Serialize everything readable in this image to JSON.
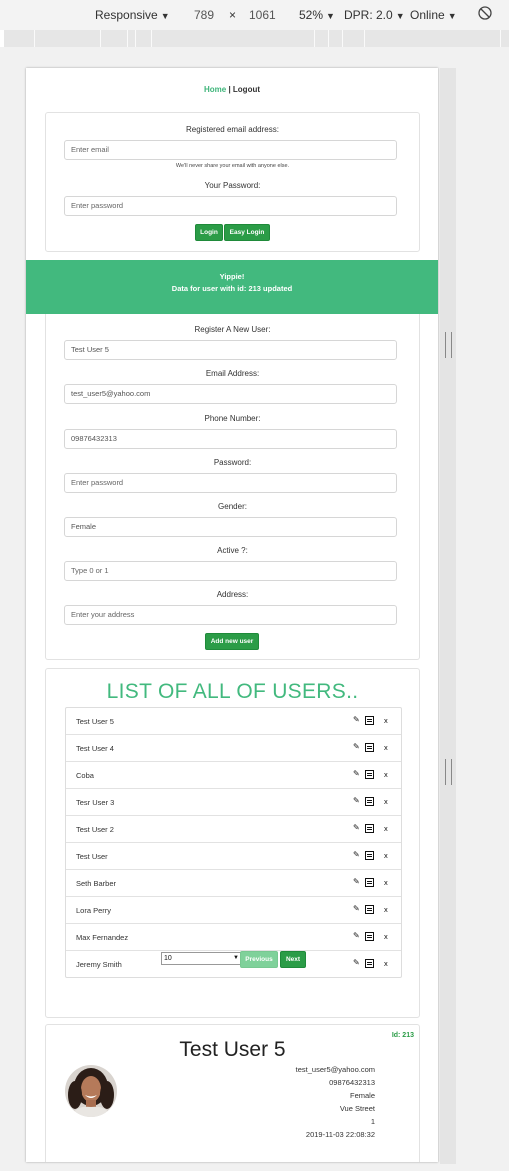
{
  "devtools": {
    "device": "Responsive",
    "width": "789",
    "times": "×",
    "height": "1061",
    "zoom": "52%",
    "dpr": "DPR: 2.0",
    "network": "Online"
  },
  "nav": {
    "home": "Home",
    "sep": " | ",
    "logout": "Logout"
  },
  "login": {
    "email_label": "Registered email address:",
    "email_placeholder": "Enter email",
    "email_hint": "We'll never share your email with anyone else.",
    "password_label": "Your Password:",
    "password_placeholder": "Enter password",
    "login_button": "Login",
    "easy_login_button": "Easy Login"
  },
  "alert": {
    "title": "Yippie!",
    "message": "Data for user with id: 213 updated"
  },
  "register": {
    "name_label": "Register A New User:",
    "name_value": "Test User 5",
    "email_label": "Email Address:",
    "email_value": "test_user5@yahoo.com",
    "phone_label": "Phone Number:",
    "phone_value": "09876432313",
    "password_label": "Password:",
    "password_placeholder": "Enter password",
    "gender_label": "Gender:",
    "gender_value": "Female",
    "active_label": "Active ?:",
    "active_placeholder": "Type 0 or 1",
    "address_label": "Address:",
    "address_placeholder": "Enter your address",
    "add_button": "Add new user"
  },
  "users": {
    "title": "LIST OF ALL OF USERS..",
    "items": [
      "Test User 5",
      "Test User 4",
      "Coba",
      "Tesr User 3",
      "Test User 2",
      "Test User",
      "Seth Barber",
      "Lora Perry",
      "Max Fernandez",
      "Jeremy Smith"
    ],
    "delete_label": "x",
    "page_size": "10",
    "previous": "Previous",
    "next": "Next"
  },
  "profile": {
    "name": "Test User 5",
    "id_label": "Id: 213",
    "email": "test_user5@yahoo.com",
    "phone": "09876432313",
    "gender": "Female",
    "address": "Vue Street",
    "active": "1",
    "updated": "2019-11-03 22:08:32"
  },
  "colors": {
    "accent": "#42b97e",
    "button": "#2b9c47",
    "button_light": "#7fd19a"
  }
}
